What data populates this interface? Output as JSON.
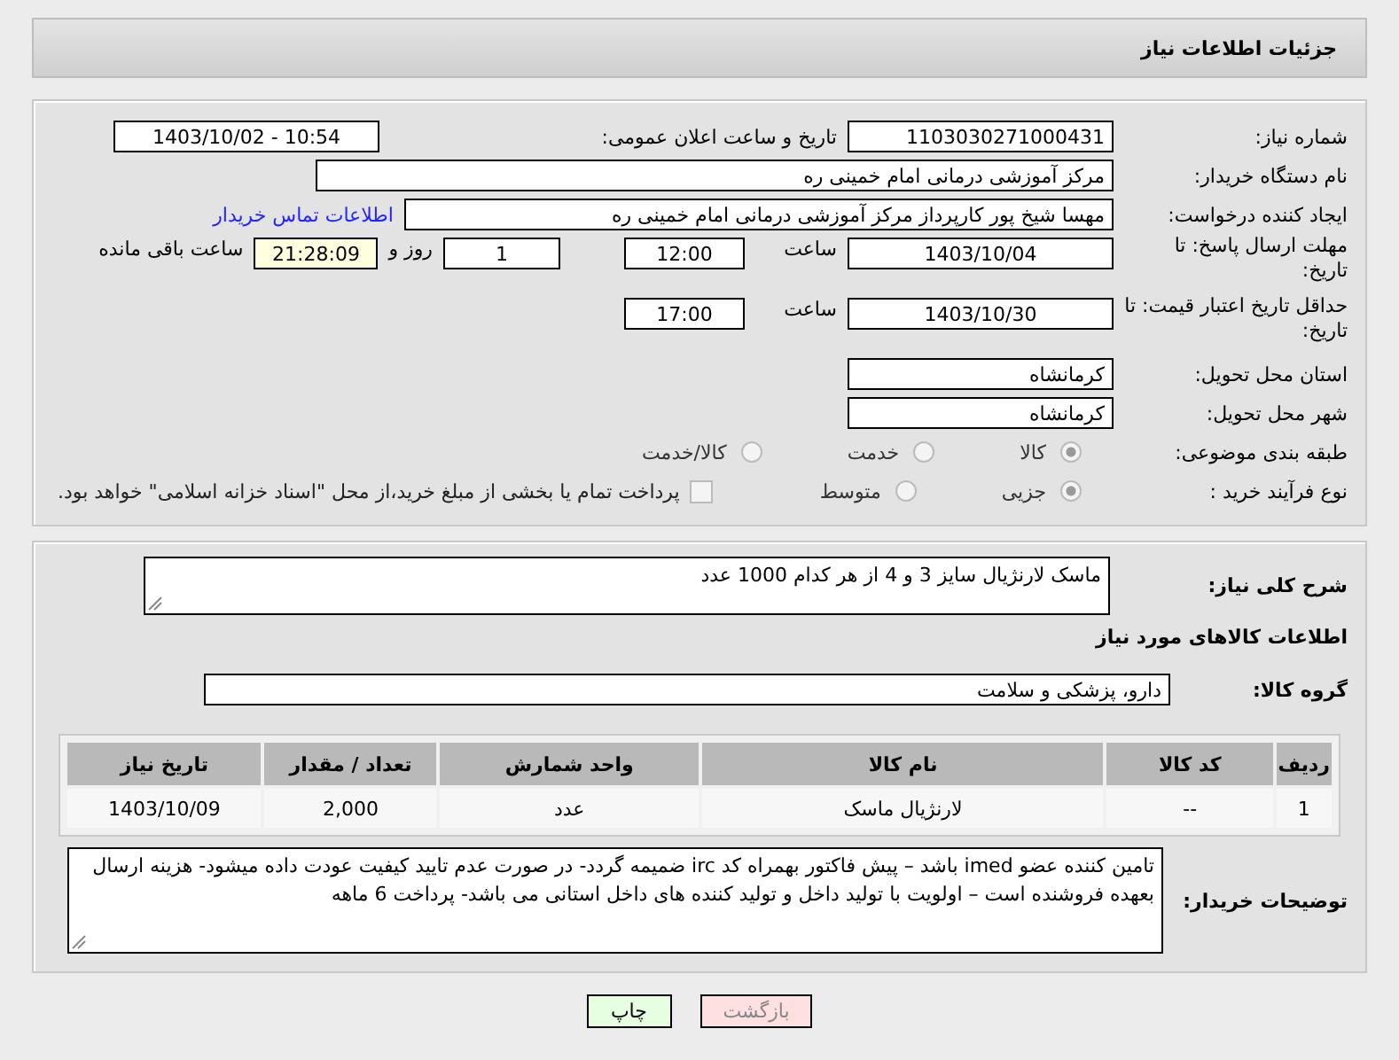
{
  "header": {
    "title": "جزئیات اطلاعات نیاز"
  },
  "details": {
    "need_number": {
      "label": "شماره نیاز:",
      "value": "1103030271000431"
    },
    "announce": {
      "label": "تاریخ و ساعت اعلان عمومی:",
      "value": "1403/10/02 - 10:54"
    },
    "buyer_org": {
      "label": "نام دستگاه خریدار:",
      "value": "مرکز آموزشی درمانی امام خمینی ره"
    },
    "requester": {
      "label": "ایجاد کننده درخواست:",
      "value": "مهسا شیخ پور کارپرداز مرکز آموزشی درمانی امام خمینی ره",
      "link": "اطلاعات تماس خریدار"
    },
    "reply_deadline": {
      "label": "مهلت ارسال پاسخ: تا تاریخ:",
      "date": "1403/10/04",
      "time_label": "ساعت",
      "time": "12:00",
      "days": "1",
      "days_label": "روز و",
      "remaining": "21:28:09",
      "remaining_label": "ساعت باقی مانده"
    },
    "price_validity": {
      "label": "حداقل تاریخ اعتبار قیمت: تا تاریخ:",
      "date": "1403/10/30",
      "time_label": "ساعت",
      "time": "17:00"
    },
    "province": {
      "label": "استان محل تحویل:",
      "value": "کرمانشاه"
    },
    "city": {
      "label": "شهر محل تحویل:",
      "value": "کرمانشاه"
    },
    "category": {
      "label": "طبقه بندی موضوعی:",
      "options": [
        {
          "label": "کالا",
          "selected": true
        },
        {
          "label": "خدمت",
          "selected": false
        },
        {
          "label": "کالا/خدمت",
          "selected": false
        }
      ]
    },
    "purchase_type": {
      "label": "نوع فرآیند خرید :",
      "options": [
        {
          "label": "جزیی",
          "selected": true
        },
        {
          "label": "متوسط",
          "selected": false
        }
      ],
      "payment": {
        "label": "پرداخت تمام یا بخشی از مبلغ خرید،از محل \"اسناد خزانه اسلامی\" خواهد بود.",
        "checked": false
      }
    }
  },
  "items": {
    "description": {
      "label": "شرح کلی نیاز:",
      "value": "ماسک لارنژیال سایز 3 و 4 از هر کدام 1000 عدد"
    },
    "section_title": "اطلاعات کالاهای مورد نیاز",
    "group": {
      "label": "گروه کالا:",
      "value": "دارو، پزشکی و سلامت"
    },
    "table": {
      "columns": [
        "ردیف",
        "کد کالا",
        "نام کالا",
        "واحد شمارش",
        "تعداد / مقدار",
        "تاریخ نیاز"
      ],
      "rows": [
        [
          "1",
          "--",
          "لارنژیال ماسک",
          "عدد",
          "2,000",
          "1403/10/09"
        ]
      ]
    },
    "buyer_notes": {
      "label": "توضیحات خریدار:",
      "value": "تامین کننده عضو imed باشد – پیش فاکتور بهمراه کد irc ضمیمه گردد- در صورت عدم تایید کیفیت عودت داده میشود- هزینه ارسال بعهده فروشنده است – اولویت با تولید داخل و تولید کننده های داخل استانی می باشد- پرداخت 6 ماهه"
    }
  },
  "buttons": {
    "print": "چاپ",
    "back": "بازگشت"
  }
}
